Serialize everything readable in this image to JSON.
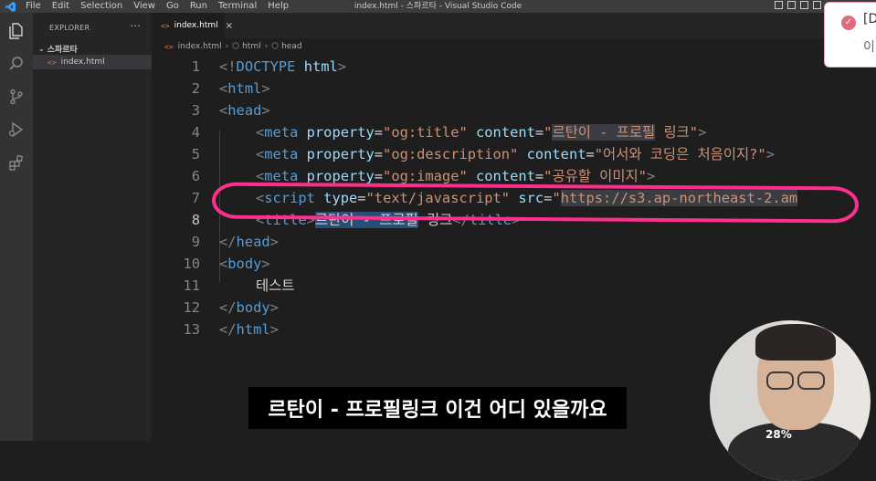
{
  "window": {
    "title": "index.html - 스파르타 - Visual Studio Code",
    "menu": [
      "File",
      "Edit",
      "Selection",
      "View",
      "Go",
      "Run",
      "Terminal",
      "Help"
    ]
  },
  "sidebar": {
    "header": "EXPLORER",
    "folder": "스파르타",
    "files": [
      "index.html"
    ]
  },
  "tab": {
    "label": "index.html"
  },
  "breadcrumb": [
    "index.html",
    "html",
    "head"
  ],
  "editor": {
    "active_line": 8,
    "lines": [
      {
        "n": "1",
        "indent": 0,
        "tokens": [
          [
            "tag",
            "<!"
          ],
          [
            "kw",
            "DOCTYPE"
          ],
          [
            "txt",
            " "
          ],
          [
            "attr",
            "html"
          ],
          [
            "tag",
            ">"
          ]
        ]
      },
      {
        "n": "2",
        "indent": 0,
        "tokens": [
          [
            "tag",
            "<"
          ],
          [
            "name",
            "html"
          ],
          [
            "tag",
            ">"
          ]
        ]
      },
      {
        "n": "3",
        "indent": 0,
        "tokens": [
          [
            "tag",
            "<"
          ],
          [
            "name",
            "head"
          ],
          [
            "tag",
            ">"
          ]
        ]
      },
      {
        "n": "4",
        "indent": 1,
        "tokens": [
          [
            "tag",
            "<"
          ],
          [
            "name",
            "meta"
          ],
          [
            "txt",
            " "
          ],
          [
            "attr",
            "property"
          ],
          [
            "txt",
            "="
          ],
          [
            "str",
            "\"og:title\""
          ],
          [
            "txt",
            " "
          ],
          [
            "attr",
            "content"
          ],
          [
            "txt",
            "="
          ],
          [
            "str",
            "\""
          ],
          [
            "str_hl",
            "르탄이 - 프로필"
          ],
          [
            "str",
            " 링크\""
          ],
          [
            "tag",
            ">"
          ]
        ]
      },
      {
        "n": "5",
        "indent": 1,
        "tokens": [
          [
            "tag",
            "<"
          ],
          [
            "name",
            "meta"
          ],
          [
            "txt",
            " "
          ],
          [
            "attr",
            "property"
          ],
          [
            "txt",
            "="
          ],
          [
            "str",
            "\"og:description\""
          ],
          [
            "txt",
            " "
          ],
          [
            "attr",
            "content"
          ],
          [
            "txt",
            "="
          ],
          [
            "str",
            "\"어서와 코딩은 처음이지?\""
          ],
          [
            "tag",
            ">"
          ]
        ]
      },
      {
        "n": "6",
        "indent": 1,
        "tokens": [
          [
            "tag",
            "<"
          ],
          [
            "name",
            "meta"
          ],
          [
            "txt",
            " "
          ],
          [
            "attr",
            "property"
          ],
          [
            "txt",
            "="
          ],
          [
            "str",
            "\"og:image\""
          ],
          [
            "txt",
            " "
          ],
          [
            "attr",
            "content"
          ],
          [
            "txt",
            "="
          ],
          [
            "str",
            "\"공유할 이미지\""
          ],
          [
            "tag",
            ">"
          ]
        ]
      },
      {
        "n": "7",
        "indent": 1,
        "tokens": [
          [
            "tag",
            "<"
          ],
          [
            "name",
            "script"
          ],
          [
            "txt",
            " "
          ],
          [
            "attr",
            "type"
          ],
          [
            "txt",
            "="
          ],
          [
            "str",
            "\"text/javascript\""
          ],
          [
            "txt",
            " "
          ],
          [
            "attr",
            "src"
          ],
          [
            "txt",
            "="
          ],
          [
            "str",
            "\""
          ],
          [
            "str_hl",
            "https://s3.ap-northeast-2.am"
          ]
        ]
      },
      {
        "n": "8",
        "indent": 1,
        "tokens": [
          [
            "tag",
            "<"
          ],
          [
            "name",
            "title"
          ],
          [
            "tag",
            ">"
          ],
          [
            "sel",
            "르탄이 - 프로필"
          ],
          [
            "txt",
            " 링크"
          ],
          [
            "tag",
            "</"
          ],
          [
            "name",
            "title"
          ],
          [
            "tag",
            ">"
          ]
        ]
      },
      {
        "n": "9",
        "indent": 0,
        "tokens": [
          [
            "tag",
            "</"
          ],
          [
            "name",
            "head"
          ],
          [
            "tag",
            ">"
          ]
        ]
      },
      {
        "n": "10",
        "indent": 0,
        "tokens": [
          [
            "tag",
            "<"
          ],
          [
            "name",
            "body"
          ],
          [
            "tag",
            ">"
          ]
        ]
      },
      {
        "n": "11",
        "indent": 1,
        "tokens": [
          [
            "txt",
            "테스트"
          ]
        ]
      },
      {
        "n": "12",
        "indent": 0,
        "tokens": [
          [
            "tag",
            "</"
          ],
          [
            "name",
            "body"
          ],
          [
            "tag",
            ">"
          ]
        ]
      },
      {
        "n": "13",
        "indent": 0,
        "tokens": [
          [
            "tag",
            "</"
          ],
          [
            "name",
            "html"
          ],
          [
            "tag",
            ">"
          ]
        ]
      }
    ]
  },
  "notification": {
    "line1": "[D",
    "line2": "이"
  },
  "subtitle": "르탄이 - 프로필링크 이건 어디 있을까요",
  "webcam": {
    "zoom": "28%"
  },
  "colors": {
    "annotation": "#ff2f8e",
    "tag": "#808080",
    "element": "#569cd6",
    "attribute": "#9cdcfe",
    "string": "#ce9178"
  },
  "icons": {
    "activity": [
      "files-icon",
      "search-icon",
      "source-control-icon",
      "run-debug-icon",
      "extensions-icon"
    ]
  }
}
